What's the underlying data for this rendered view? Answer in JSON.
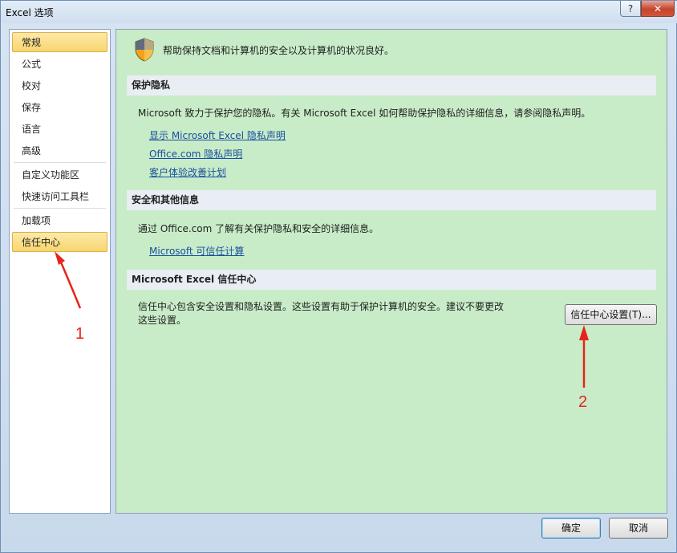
{
  "window": {
    "title": "Excel 选项",
    "help_symbol": "?",
    "close_symbol": "✕"
  },
  "nav": {
    "items": [
      {
        "label": "常规",
        "active": false
      },
      {
        "label": "公式"
      },
      {
        "label": "校对"
      },
      {
        "label": "保存"
      },
      {
        "label": "语言"
      },
      {
        "label": "高级"
      },
      {
        "label": "自定义功能区"
      },
      {
        "label": "快速访问工具栏"
      },
      {
        "label": "加载项"
      },
      {
        "label": "信任中心",
        "active": true
      }
    ]
  },
  "content": {
    "header": "帮助保持文档和计算机的安全以及计算机的状况良好。",
    "privacy": {
      "title": "保护隐私",
      "text": "Microsoft 致力于保护您的隐私。有关 Microsoft Excel 如何帮助保护隐私的详细信息，请参阅隐私声明。",
      "links": [
        "显示 Microsoft Excel 隐私声明",
        "Office.com 隐私声明",
        "客户体验改善计划"
      ]
    },
    "security": {
      "title": "安全和其他信息",
      "text": "通过 Office.com 了解有关保护隐私和安全的详细信息。",
      "links": [
        "Microsoft 可信任计算"
      ]
    },
    "trust_center": {
      "title": "Microsoft Excel 信任中心",
      "text_line1": "信任中心包含安全设置和隐私设置。这些设置有助于保护计算机的安全。建议不要更改",
      "text_line2": "这些设置。",
      "button": "信任中心设置(T)..."
    }
  },
  "footer": {
    "ok": "确定",
    "cancel": "取消"
  },
  "annotations": {
    "label1": "1",
    "label2": "2",
    "color": "#e8231a"
  }
}
